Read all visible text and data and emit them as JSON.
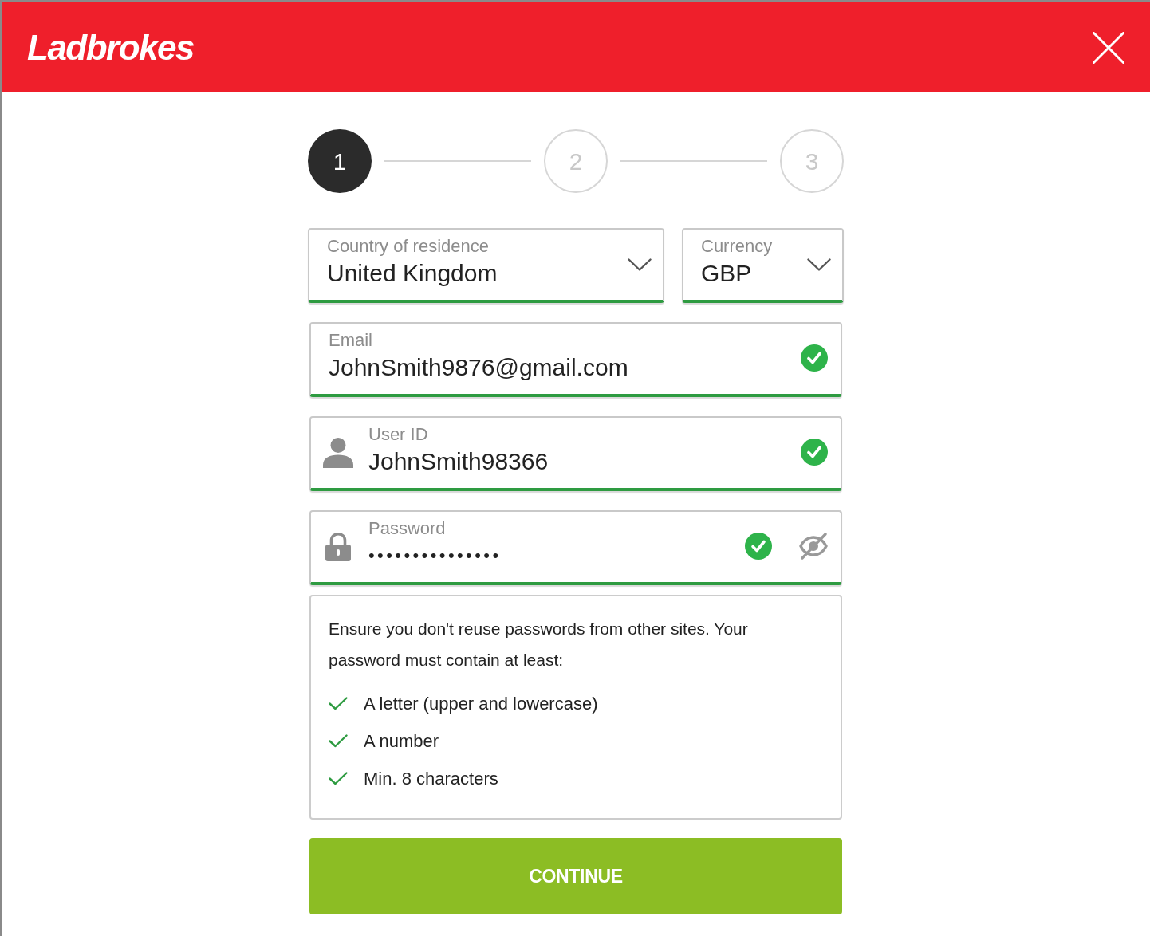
{
  "header": {
    "logo": "Ladbrokes"
  },
  "steps": [
    {
      "label": "1",
      "selected": true
    },
    {
      "label": "2",
      "selected": false
    },
    {
      "label": "3",
      "selected": false
    }
  ],
  "selects": [
    {
      "label": "Country of residence",
      "value": "United Kingdom",
      "valid": true
    },
    {
      "label": "Currency",
      "value": "GBP",
      "valid": true
    }
  ],
  "fields": [
    {
      "kind": "email",
      "label": "Email",
      "value": "JohnSmith9876@gmail.com",
      "valid": true
    },
    {
      "kind": "user",
      "label": "User ID",
      "value": "JohnSmith98366",
      "valid": true
    },
    {
      "kind": "password",
      "label": "Password",
      "value": "•••••••••••••••",
      "valid": true,
      "revealed": false
    }
  ],
  "password_hint": {
    "text": "Ensure you don't reuse passwords from other sites. Your password must contain at least:",
    "requirements": [
      {
        "text": "A letter (upper and lowercase)",
        "met": true
      },
      {
        "text": "A number",
        "met": true
      },
      {
        "text": "Min. 8 characters",
        "met": true
      }
    ]
  },
  "continue_button": {
    "label": "CONTINUE"
  }
}
